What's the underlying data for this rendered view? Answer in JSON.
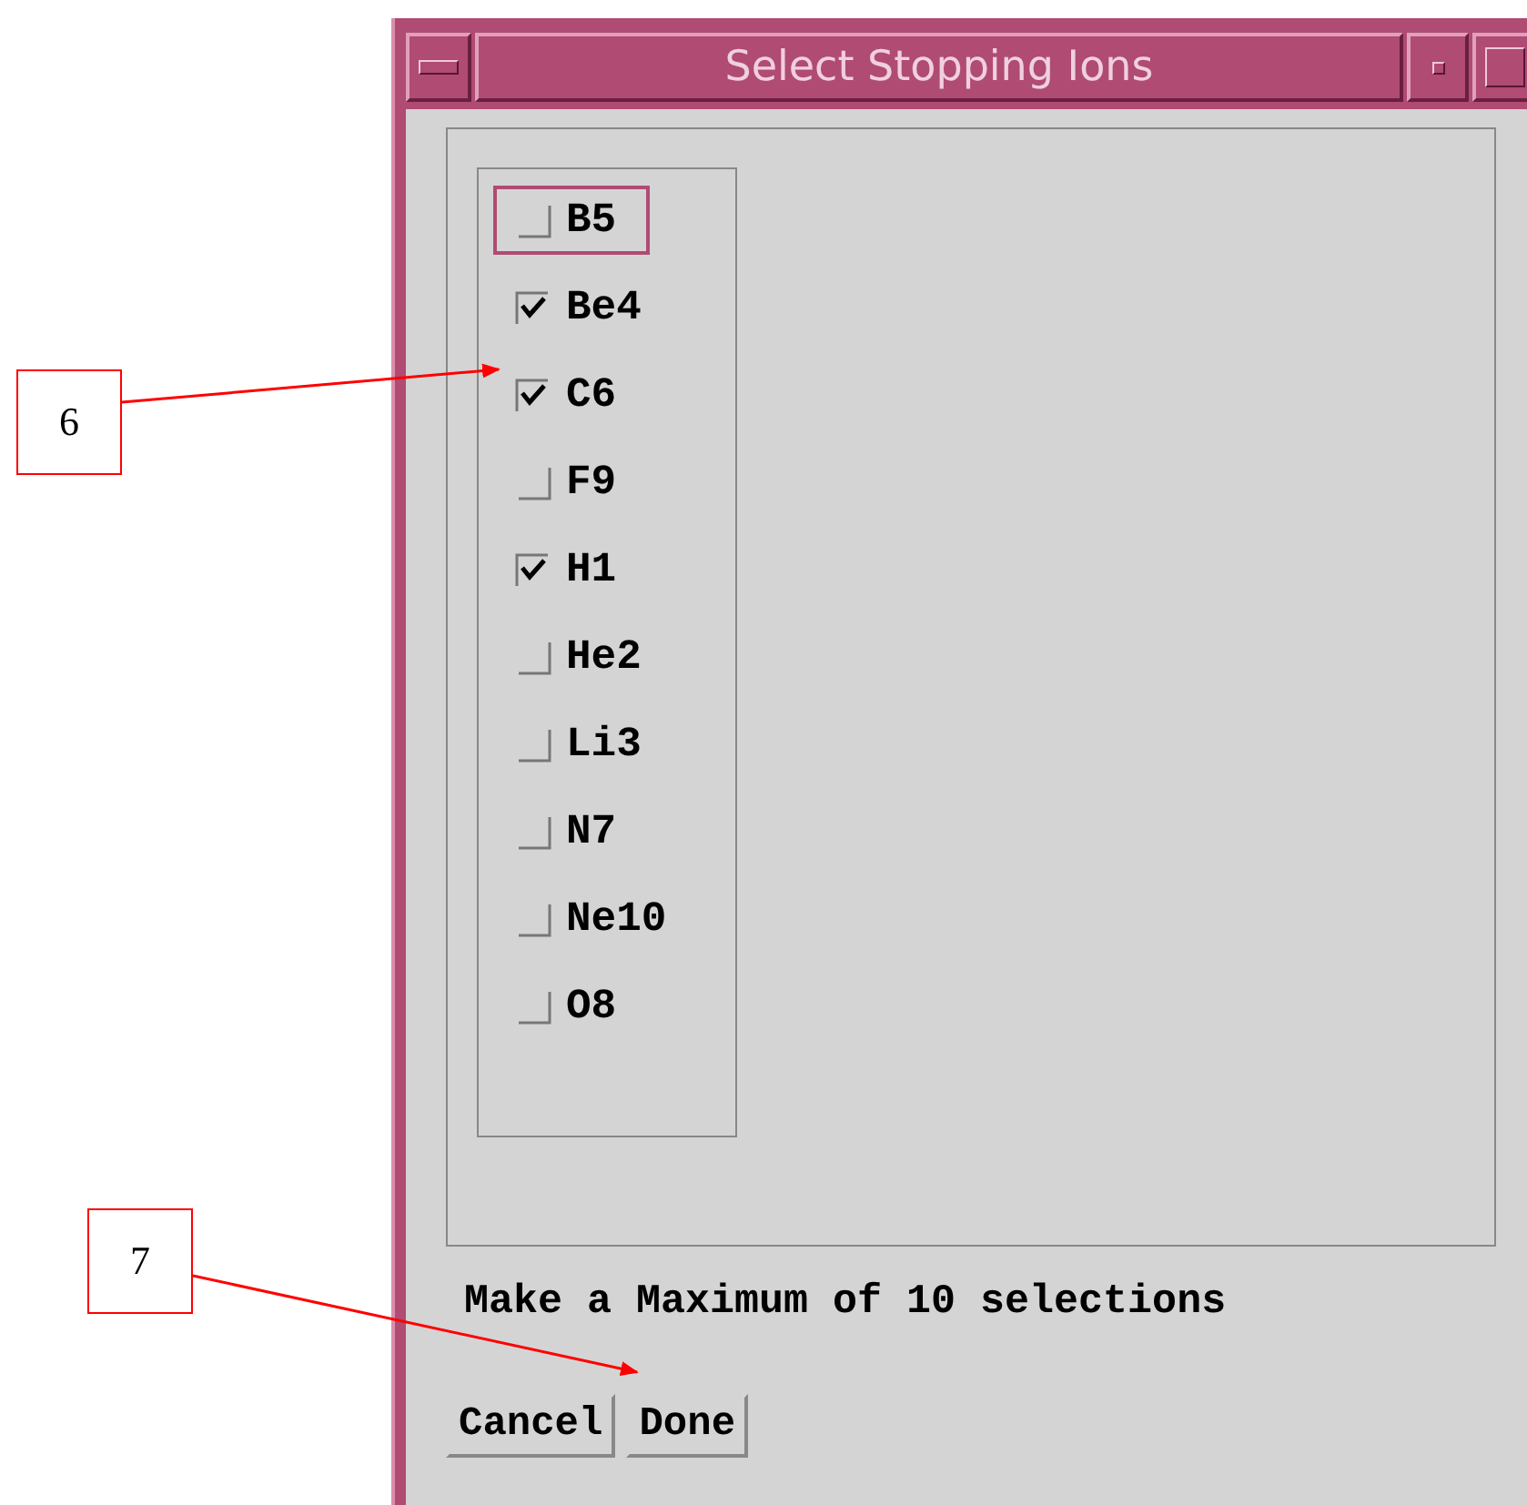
{
  "window": {
    "title": "Select Stopping Ions"
  },
  "ions": [
    {
      "label": "B5",
      "checked": false,
      "focused": true
    },
    {
      "label": "Be4",
      "checked": true,
      "focused": false
    },
    {
      "label": "C6",
      "checked": true,
      "focused": false
    },
    {
      "label": "F9",
      "checked": false,
      "focused": false
    },
    {
      "label": "H1",
      "checked": true,
      "focused": false
    },
    {
      "label": "He2",
      "checked": false,
      "focused": false
    },
    {
      "label": "Li3",
      "checked": false,
      "focused": false
    },
    {
      "label": "N7",
      "checked": false,
      "focused": false
    },
    {
      "label": "Ne10",
      "checked": false,
      "focused": false
    },
    {
      "label": "O8",
      "checked": false,
      "focused": false
    }
  ],
  "message": "Make a Maximum of 10 selections",
  "buttons": [
    "Cancel",
    "Done"
  ],
  "callouts": [
    "6",
    "7"
  ]
}
